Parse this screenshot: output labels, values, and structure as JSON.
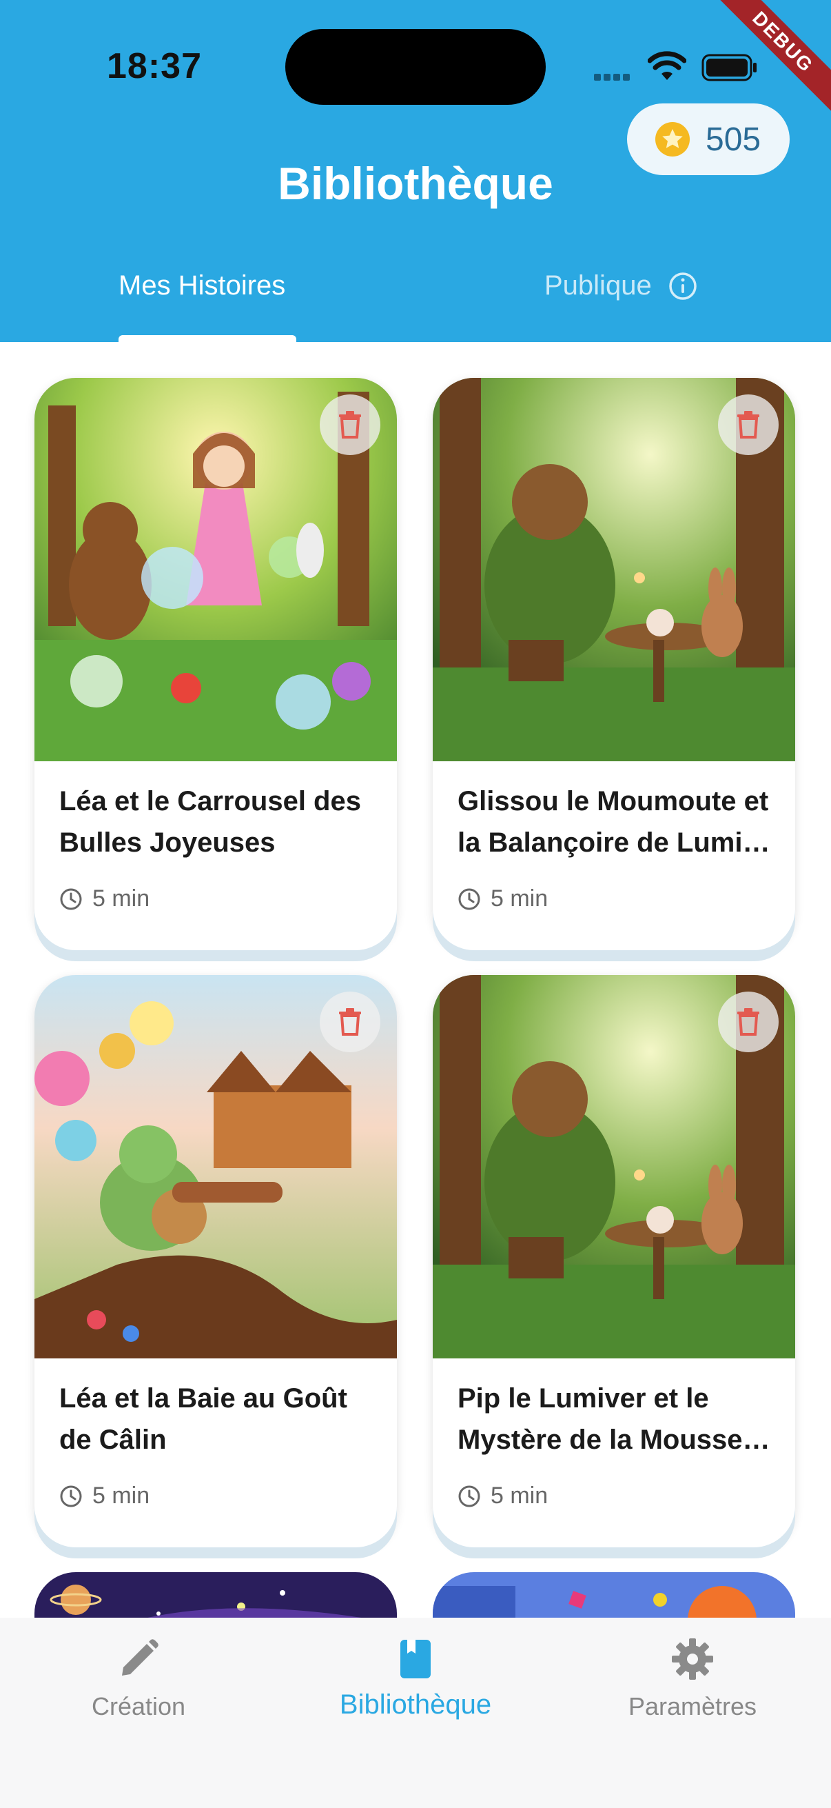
{
  "status_bar": {
    "time": "18:37"
  },
  "debug_label": "DEBUG",
  "coins": {
    "value": "505"
  },
  "header": {
    "title": "Bibliothèque"
  },
  "tabs": [
    {
      "label": "Mes Histoires",
      "active": true
    },
    {
      "label": "Publique",
      "active": false
    }
  ],
  "stories": [
    {
      "title": "Léa et le Carrousel des Bulles Joyeuses",
      "duration": "5 min",
      "scene": "enchanted forest with girl, bear, rabbit and owl among bubbles"
    },
    {
      "title": "Glissou le Moumoute et la Balançoire de Lumi…",
      "duration": "5 min",
      "scene": "bear in green sweater having tea with rabbit in forest"
    },
    {
      "title": "Léa et la Baie au Goût de Câlin",
      "duration": "5 min",
      "scene": "candy land with baby dragon, gingerbread houses and chocolate river"
    },
    {
      "title": "Pip le Lumiver et le Mystère de la Mousse…",
      "duration": "5 min",
      "scene": "bear in green sweater having tea with rabbit in forest"
    }
  ],
  "bottom_nav": [
    {
      "label": "Création",
      "icon": "pencil-icon",
      "active": false
    },
    {
      "label": "Bibliothèque",
      "icon": "book-icon",
      "active": true
    },
    {
      "label": "Paramètres",
      "icon": "gear-icon",
      "active": false
    }
  ],
  "colors": {
    "primary": "#2AA8E2",
    "delete": "#E35A50",
    "coin": "#F5B921"
  }
}
